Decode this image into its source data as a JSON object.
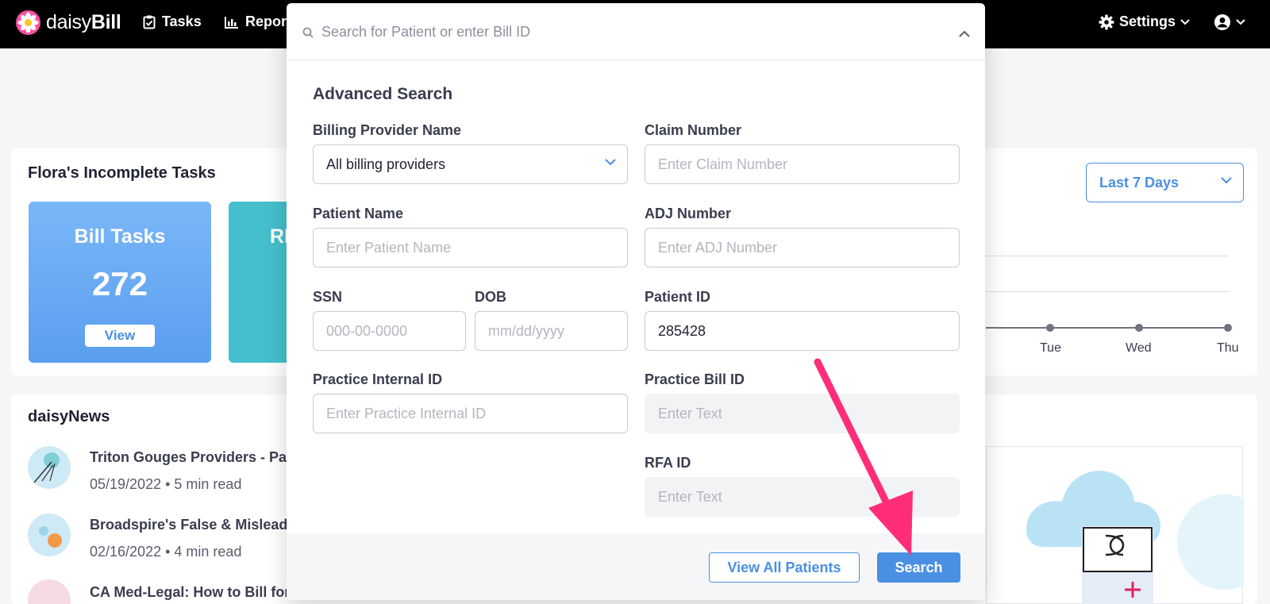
{
  "topbar": {
    "logo_prefix": "daisy",
    "logo_suffix": "Bill",
    "nav": [
      {
        "label": "Tasks",
        "icon": "clipboard-check-icon"
      },
      {
        "label": "Repor",
        "icon": "bar-chart-icon"
      }
    ],
    "settings_label": "Settings",
    "user_icon": "user-circle-icon"
  },
  "tasks_card": {
    "title": "Flora's Incomplete Tasks",
    "tiles": [
      {
        "title": "Bill Tasks",
        "count": "272",
        "button": "View",
        "color": "#6aa8f2"
      },
      {
        "title": "RF",
        "count": "",
        "button": "",
        "color": "#45bfcc"
      }
    ]
  },
  "chart_panel": {
    "range": "Last 7 Days",
    "days": [
      "Tue",
      "Wed",
      "Thu"
    ]
  },
  "news": {
    "title": "daisyNews",
    "items": [
      {
        "title": "Triton Gouges Providers - Pay",
        "date": "05/19/2022",
        "read": "5 min read"
      },
      {
        "title": "Broadspire's False & Misleadi",
        "date": "02/16/2022",
        "read": "4 min read"
      },
      {
        "title": "CA Med-Legal: How to Bill for",
        "date": "",
        "read": ""
      }
    ]
  },
  "modal": {
    "search_placeholder": "Search for Patient or enter Bill ID",
    "advanced_title": "Advanced Search",
    "fields": {
      "billing_provider": {
        "label": "Billing Provider Name",
        "value": "All billing providers"
      },
      "claim_number": {
        "label": "Claim Number",
        "placeholder": "Enter Claim Number"
      },
      "patient_name": {
        "label": "Patient Name",
        "placeholder": "Enter Patient Name"
      },
      "adj_number": {
        "label": "ADJ Number",
        "placeholder": "Enter ADJ Number"
      },
      "ssn": {
        "label": "SSN",
        "placeholder": "000-00-0000"
      },
      "dob": {
        "label": "DOB",
        "placeholder": "mm/dd/yyyy"
      },
      "patient_id": {
        "label": "Patient ID",
        "value": "285428"
      },
      "practice_internal_id": {
        "label": "Practice Internal ID",
        "placeholder": "Enter Practice Internal ID"
      },
      "practice_bill_id": {
        "label": "Practice Bill ID",
        "placeholder": "Enter Text"
      },
      "rfa_id": {
        "label": "RFA ID",
        "placeholder": "Enter Text"
      }
    },
    "buttons": {
      "view_all": "View All Patients",
      "search": "Search"
    }
  },
  "colors": {
    "accent": "#4a90e2",
    "annotation": "#ff2d78"
  }
}
